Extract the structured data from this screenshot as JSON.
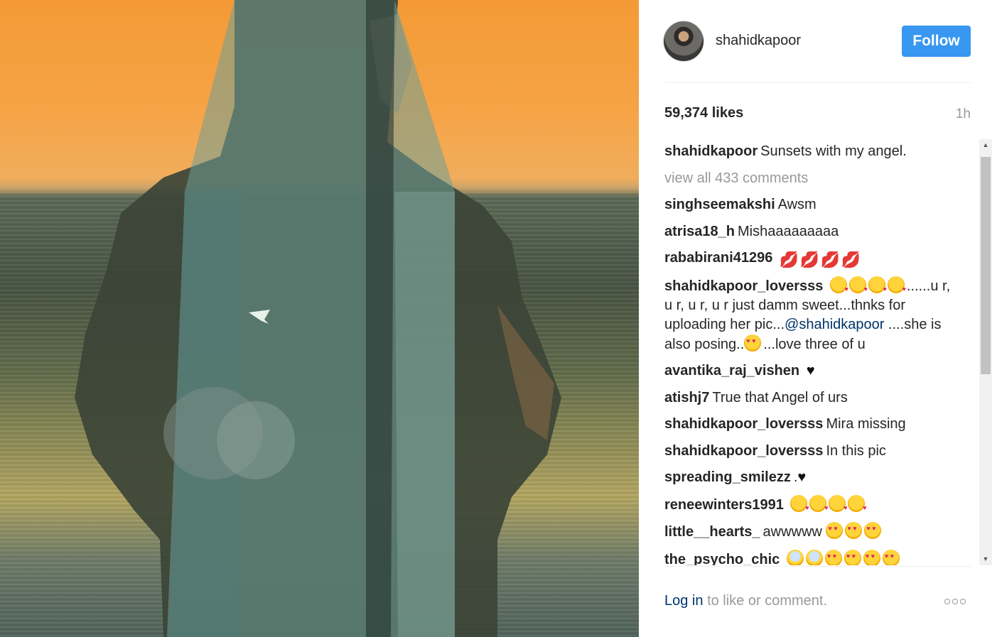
{
  "post": {
    "username": "shahidkapoor",
    "follow_label": "Follow",
    "likes": "59,374 likes",
    "time": "1h",
    "caption_user": "shahidkapoor",
    "caption_text": "Sunsets with my angel.",
    "view_all": "view all 433 comments",
    "login_label": "Log in",
    "login_suffix": "to like or comment."
  },
  "comments": [
    {
      "user": "singhseemakshi",
      "text": "Awsm"
    },
    {
      "user": "atrisa18_h",
      "text": "Mishaaaaaaaaa"
    },
    {
      "user": "rababirani41296",
      "text": ""
    },
    {
      "user": "shahidkapoor_loversss",
      "text_a": "......u r, u r, u r, u r just damm sweet...thnks for uploading her pic...",
      "mention": "@shahidkapoor",
      "text_b": "....she is also posing..",
      "text_c": "...love three of u"
    },
    {
      "user": "avantika_raj_vishen",
      "text": ""
    },
    {
      "user": "atishj7",
      "text": "True that Angel of urs"
    },
    {
      "user": "shahidkapoor_loversss",
      "text": "Mira missing"
    },
    {
      "user": "shahidkapoor_loversss",
      "text": "In this pic"
    },
    {
      "user": "spreading_smilezz",
      "text": "."
    },
    {
      "user": "reneewinters1991",
      "text": ""
    },
    {
      "user": "little__hearts_",
      "text": "awwwww"
    },
    {
      "user": "the_psycho_chic",
      "text": ""
    }
  ],
  "icons": {
    "lips": "💋",
    "black_heart": "♥",
    "scroll_up": "▲",
    "scroll_down": "▼"
  },
  "colors": {
    "accent": "#3897f0",
    "link": "#003569",
    "muted": "#999999"
  }
}
